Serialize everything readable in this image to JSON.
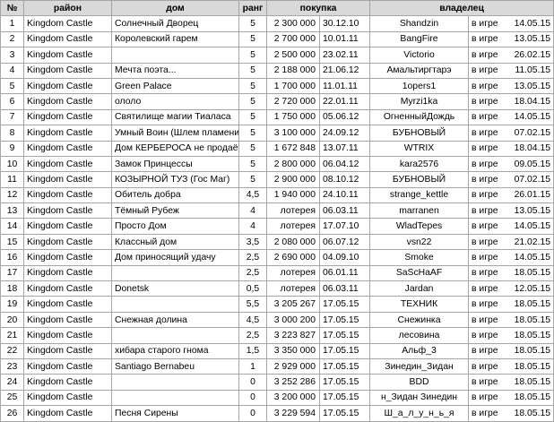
{
  "headers": {
    "num": "№",
    "district": "район",
    "house": "дом",
    "rank": "ранг",
    "purchase": "покупка",
    "owner": "владелец"
  },
  "rows": [
    {
      "num": "1",
      "district": "Kingdom Castle",
      "house": "Солнечный Дворец",
      "rank": "5",
      "price": "2 300 000",
      "date": "30.12.10",
      "owner": "Shandzin",
      "status": "в игре",
      "odate": "14.05.15"
    },
    {
      "num": "2",
      "district": "Kingdom Castle",
      "house": "Королевский гарем",
      "rank": "5",
      "price": "2 700 000",
      "date": "10.01.11",
      "owner": "BangFire",
      "status": "в игре",
      "odate": "13.05.15"
    },
    {
      "num": "3",
      "district": "Kingdom Castle",
      "house": "",
      "rank": "5",
      "price": "2 500 000",
      "date": "23.02.11",
      "owner": "Victorio",
      "status": "в игре",
      "odate": "26.02.15"
    },
    {
      "num": "4",
      "district": "Kingdom Castle",
      "house": "Мечта поэта...",
      "rank": "5",
      "price": "2 188 000",
      "date": "21.06.12",
      "owner": "Амальтиргтарэ",
      "status": "в игре",
      "odate": "11.05.15"
    },
    {
      "num": "5",
      "district": "Kingdom Castle",
      "house": "Green Palace",
      "rank": "5",
      "price": "1 700 000",
      "date": "11.01.11",
      "owner": "1opers1",
      "status": "в игре",
      "odate": "13.05.15"
    },
    {
      "num": "6",
      "district": "Kingdom Castle",
      "house": "ололо",
      "rank": "5",
      "price": "2 720 000",
      "date": "22.01.11",
      "owner": "Myrzi1ka",
      "status": "в игре",
      "odate": "18.04.15"
    },
    {
      "num": "7",
      "district": "Kingdom Castle",
      "house": "Святилище магии Тиаласа",
      "rank": "5",
      "price": "1 750 000",
      "date": "05.06.12",
      "owner": "ОгненныйДождь",
      "status": "в игре",
      "odate": "14.05.15"
    },
    {
      "num": "8",
      "district": "Kingdom Castle",
      "house": "Умный Воин (Шлем пламени)",
      "rank": "5",
      "price": "3 100 000",
      "date": "24.09.12",
      "owner": "БУБНОВЫЙ",
      "status": "в игре",
      "odate": "07.02.15"
    },
    {
      "num": "9",
      "district": "Kingdom Castle",
      "house": "Дом КЕРБЕРОСА не продаётся",
      "rank": "5",
      "price": "1 672 848",
      "date": "13.07.11",
      "owner": "WTRIX",
      "status": "в игре",
      "odate": "18.04.15"
    },
    {
      "num": "10",
      "district": "Kingdom Castle",
      "house": "Замок Принцессы",
      "rank": "5",
      "price": "2 800 000",
      "date": "06.04.12",
      "owner": "kara2576",
      "status": "в игре",
      "odate": "09.05.15"
    },
    {
      "num": "11",
      "district": "Kingdom Castle",
      "house": "КОЗЫРНОЙ ТУЗ (Гос Маг)",
      "rank": "5",
      "price": "2 900 000",
      "date": "08.10.12",
      "owner": "БУБНОВЫЙ",
      "status": "в игре",
      "odate": "07.02.15"
    },
    {
      "num": "12",
      "district": "Kingdom Castle",
      "house": "Обитель добра",
      "rank": "4,5",
      "price": "1 940 000",
      "date": "24.10.11",
      "owner": "strange_kettle",
      "status": "в игре",
      "odate": "26.01.15"
    },
    {
      "num": "13",
      "district": "Kingdom Castle",
      "house": "Тёмный Рубеж",
      "rank": "4",
      "price": "лотерея",
      "date": "06.03.11",
      "owner": "marranen",
      "status": "в игре",
      "odate": "13.05.15"
    },
    {
      "num": "14",
      "district": "Kingdom Castle",
      "house": "Просто Дом",
      "rank": "4",
      "price": "лотерея",
      "date": "17.07.10",
      "owner": "WladTepes",
      "status": "в игре",
      "odate": "14.05.15"
    },
    {
      "num": "15",
      "district": "Kingdom Castle",
      "house": "Классный дом",
      "rank": "3,5",
      "price": "2 080 000",
      "date": "06.07.12",
      "owner": "vsn22",
      "status": "в игре",
      "odate": "21.02.15"
    },
    {
      "num": "16",
      "district": "Kingdom Castle",
      "house": "Дом приносящий удачу",
      "rank": "2,5",
      "price": "2 690 000",
      "date": "04.09.10",
      "owner": "Smoke",
      "status": "в игре",
      "odate": "14.05.15"
    },
    {
      "num": "17",
      "district": "Kingdom Castle",
      "house": "",
      "rank": "2,5",
      "price": "лотерея",
      "date": "06.01.11",
      "owner": "SaScHaAF",
      "status": "в игре",
      "odate": "18.05.15"
    },
    {
      "num": "18",
      "district": "Kingdom Castle",
      "house": "Donetsk",
      "rank": "0,5",
      "price": "лотерея",
      "date": "06.03.11",
      "owner": "Jardan",
      "status": "в игре",
      "odate": "12.05.15"
    },
    {
      "num": "19",
      "district": "Kingdom Castle",
      "house": "",
      "rank": "5,5",
      "price": "3 205 267",
      "date": "17.05.15",
      "owner": "ТЕХНИК",
      "status": "в игре",
      "odate": "18.05.15"
    },
    {
      "num": "20",
      "district": "Kingdom Castle",
      "house": "Снежная долина",
      "rank": "4,5",
      "price": "3 000 200",
      "date": "17.05.15",
      "owner": "Снежинка",
      "status": "в игре",
      "odate": "18.05.15"
    },
    {
      "num": "21",
      "district": "Kingdom Castle",
      "house": "",
      "rank": "2,5",
      "price": "3 223 827",
      "date": "17.05.15",
      "owner": "лесовина",
      "status": "в игре",
      "odate": "18.05.15"
    },
    {
      "num": "22",
      "district": "Kingdom Castle",
      "house": "хибара старого гнома",
      "rank": "1,5",
      "price": "3 350 000",
      "date": "17.05.15",
      "owner": "Альф_3",
      "status": "в игре",
      "odate": "18.05.15"
    },
    {
      "num": "23",
      "district": "Kingdom Castle",
      "house": "Santiago Bernabeu",
      "rank": "1",
      "price": "2 929 000",
      "date": "17.05.15",
      "owner": "Зинедин_Зидан",
      "status": "в игре",
      "odate": "18.05.15"
    },
    {
      "num": "24",
      "district": "Kingdom Castle",
      "house": "",
      "rank": "0",
      "price": "3 252 286",
      "date": "17.05.15",
      "owner": "BDD",
      "status": "в игре",
      "odate": "18.05.15"
    },
    {
      "num": "25",
      "district": "Kingdom Castle",
      "house": "",
      "rank": "0",
      "price": "3 200 000",
      "date": "17.05.15",
      "owner": "н_Зидан Зинедин",
      "status": "в игре",
      "odate": "18.05.15"
    },
    {
      "num": "26",
      "district": "Kingdom Castle",
      "house": "Песня Сирены",
      "rank": "0",
      "price": "3 229 594",
      "date": "17.05.15",
      "owner": "Ш_а_л_у_н_ь_я",
      "status": "в игре",
      "odate": "18.05.15"
    }
  ]
}
